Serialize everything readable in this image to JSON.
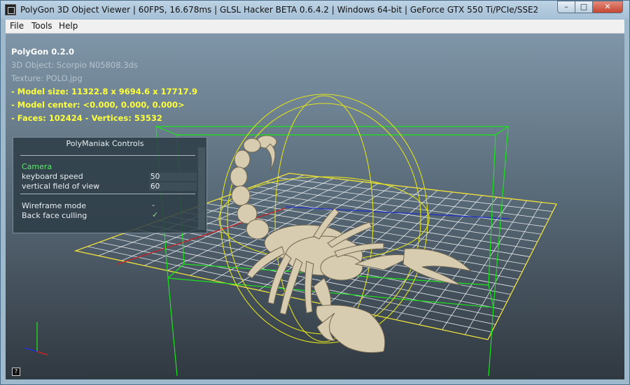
{
  "window": {
    "title": "PolyGon 3D Object Viewer | 60FPS, 16.678ms | GLSL Hacker BETA 0.6.4.2 | Windows 64-bit | GeForce GTX 550 Ti/PCIe/SSE2",
    "buttons": {
      "minimize": "–",
      "maximize": "□",
      "close": "✕"
    }
  },
  "menu": {
    "items": [
      "File",
      "Tools",
      "Help"
    ]
  },
  "overlay": {
    "app_name": "PolyGon 0.2.0",
    "object": "3D Object: Scorpio N05808.3ds",
    "texture": "Texture: POLO.jpg",
    "model_size": "- Model size:  11322.8 x 9694.6 x 17717.9",
    "model_center": "- Model center:  <0.000, 0.000, 0.000>",
    "faces_vertices": "- Faces: 102424 - Vertices: 53532"
  },
  "panel": {
    "title": "PolyManiak Controls",
    "section": "Camera",
    "keyboard_speed_label": "keyboard speed",
    "keyboard_speed_value": "50",
    "fov_label": "vertical field of view",
    "fov_value": "60",
    "wireframe_label": "Wireframe mode",
    "wireframe_value": "-",
    "backface_label": "Back face culling",
    "backface_value": "✓"
  },
  "colors": {
    "bbox": "#19e619",
    "sphere": "#e2e21a",
    "grid": "#e6eaec",
    "grid_border": "#f0e03a",
    "axis_x": "#cc2020",
    "axis_z": "#2030c8",
    "model": "#d8ccb0"
  },
  "help_icon": "question-icon"
}
